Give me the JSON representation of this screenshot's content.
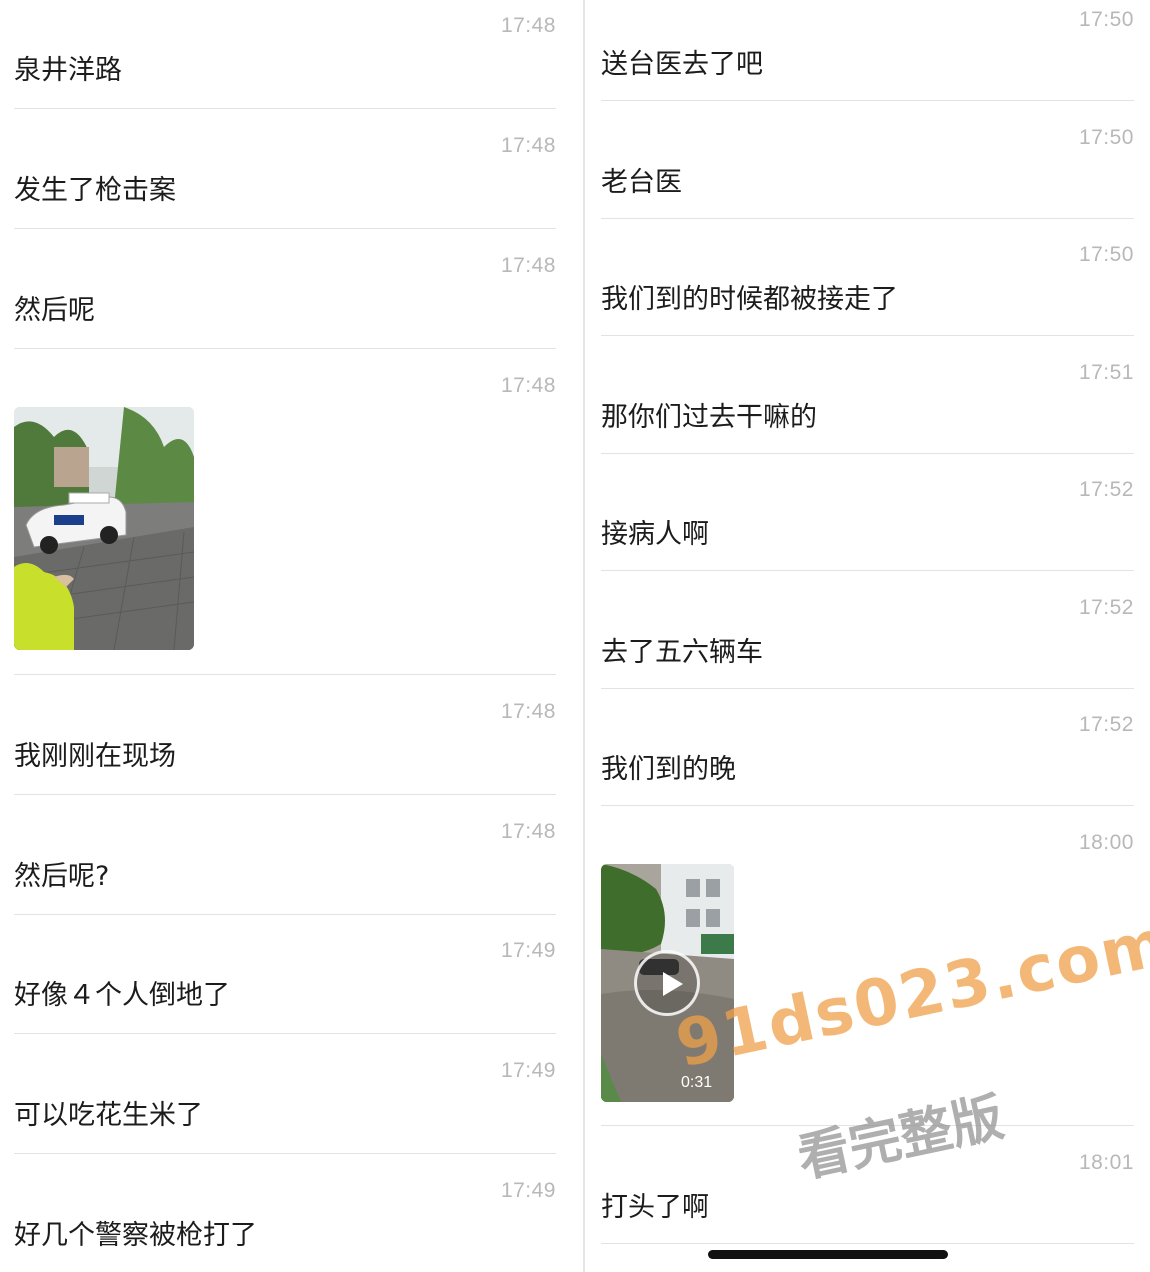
{
  "left_messages": [
    {
      "time": "17:48",
      "text": "泉井洋路"
    },
    {
      "time": "17:48",
      "text": "发生了枪击案"
    },
    {
      "time": "17:48",
      "text": "然后呢"
    },
    {
      "time": "17:48",
      "text": ""
    },
    {
      "time": "17:48",
      "text": "我刚刚在现场"
    },
    {
      "time": "17:48",
      "text": "然后呢?"
    },
    {
      "time": "17:49",
      "text": "好像４个人倒地了"
    },
    {
      "time": "17:49",
      "text": "可以吃花生米了"
    },
    {
      "time": "17:49",
      "text": "好几个警察被枪打了"
    }
  ],
  "right_messages": [
    {
      "time": "17:50",
      "text": "送台医去了吧"
    },
    {
      "time": "17:50",
      "text": "老台医"
    },
    {
      "time": "17:50",
      "text": "我们到的时候都被接走了"
    },
    {
      "time": "17:51",
      "text": "那你们过去干嘛的"
    },
    {
      "time": "17:52",
      "text": "接病人啊"
    },
    {
      "time": "17:52",
      "text": "去了五六辆车"
    },
    {
      "time": "17:52",
      "text": "我们到的晚"
    },
    {
      "time": "18:00",
      "text": ""
    },
    {
      "time": "18:01",
      "text": "打头了啊"
    }
  ],
  "video": {
    "duration": "0:31"
  },
  "watermark": {
    "url": "91ds023.com",
    "subtitle": "看完整版"
  },
  "colors": {
    "timestamp": "#b8b8b8",
    "message_text": "#1c1c1c",
    "separator": "#e3e3e3",
    "watermark_url": "#f0a14a"
  },
  "icons": {
    "video_play": "play-circle-icon"
  }
}
